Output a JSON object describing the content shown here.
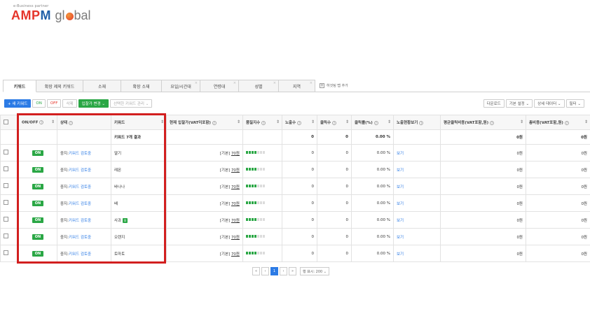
{
  "logo": {
    "tagline": "e-Business partner",
    "name_a": "AMP",
    "name_b": "M",
    "name_c": "gl",
    "name_d": "bal"
  },
  "tabs": [
    {
      "label": "키워드",
      "active": true
    },
    {
      "label": "확장 제외 키워드"
    },
    {
      "label": "소재"
    },
    {
      "label": "확장 소재"
    },
    {
      "label": "요일/시간대",
      "close": "×"
    },
    {
      "label": "연령대",
      "close": "×"
    },
    {
      "label": "성별",
      "close": "×"
    },
    {
      "label": "지역",
      "close": "×"
    }
  ],
  "tab_add_label": "하것팅 탭 추가",
  "toolbar": {
    "new_keyword": "+ 새 키워드",
    "on": "ON",
    "off": "OFF",
    "delete": "삭제",
    "bid_change": "입찰가 변경 ⌄",
    "selected_manage": "선택한 키워드 관리 ⌄",
    "download": "다운로드",
    "basic_settings": "기본 설정 ⌄",
    "detail_data": "상세 데이터 ⌄",
    "filter": "필터 ⌄"
  },
  "columns": {
    "onoff": "ON/OFF",
    "status": "상태",
    "keyword": "키워드",
    "bid": "현재 입찰가(VAT미포함)",
    "quality": "품질지수",
    "impressions": "노출수",
    "clicks": "클릭수",
    "ctr": "클릭률(%)",
    "view_exposure": "노출현황보기",
    "avg_cpc": "평균클릭비용(VAT포함,원)",
    "total_cost": "총비용(VAT포함,원)"
  },
  "summary": {
    "label": "키워드 7개 결과",
    "impressions": "0",
    "clicks": "0",
    "ctr": "0.00 %",
    "avg_cpc": "0원",
    "total_cost": "0원"
  },
  "rows": [
    {
      "onoff": "ON",
      "status_prefix": "중지:",
      "status_link": "키워드 검토중",
      "keyword": "딸기",
      "bid_prefix": "[기본]",
      "bid_value": "70원",
      "quality": 4,
      "impressions": "0",
      "clicks": "0",
      "ctr": "0.00 %",
      "view": "보기",
      "avg_cpc": "0원",
      "total_cost": "0원"
    },
    {
      "onoff": "ON",
      "status_prefix": "중지:",
      "status_link": "키워드 검토중",
      "keyword": "레몬",
      "bid_prefix": "[기본]",
      "bid_value": "70원",
      "quality": 4,
      "impressions": "0",
      "clicks": "0",
      "ctr": "0.00 %",
      "view": "보기",
      "avg_cpc": "0원",
      "total_cost": "0원"
    },
    {
      "onoff": "ON",
      "status_prefix": "중지:",
      "status_link": "키워드 검토중",
      "keyword": "바나나",
      "bid_prefix": "[기본]",
      "bid_value": "70원",
      "quality": 4,
      "impressions": "0",
      "clicks": "0",
      "ctr": "0.00 %",
      "view": "보기",
      "avg_cpc": "0원",
      "total_cost": "0원"
    },
    {
      "onoff": "ON",
      "status_prefix": "중지:",
      "status_link": "키워드 검토중",
      "keyword": "배",
      "bid_prefix": "[기본]",
      "bid_value": "70원",
      "quality": 4,
      "impressions": "0",
      "clicks": "0",
      "ctr": "0.00 %",
      "view": "보기",
      "avg_cpc": "0원",
      "total_cost": "0원"
    },
    {
      "onoff": "ON",
      "status_prefix": "중지:",
      "status_link": "키워드 검토중",
      "keyword": "사과",
      "badge": "B",
      "bid_prefix": "[기본]",
      "bid_value": "70원",
      "quality": 4,
      "impressions": "0",
      "clicks": "0",
      "ctr": "0.00 %",
      "view": "보기",
      "avg_cpc": "0원",
      "total_cost": "0원"
    },
    {
      "onoff": "ON",
      "status_prefix": "중지:",
      "status_link": "키워드 검토중",
      "keyword": "오렌지",
      "bid_prefix": "[기본]",
      "bid_value": "70원",
      "quality": 4,
      "impressions": "0",
      "clicks": "0",
      "ctr": "0.00 %",
      "view": "보기",
      "avg_cpc": "0원",
      "total_cost": "0원"
    },
    {
      "onoff": "ON",
      "status_prefix": "중지:",
      "status_link": "키워드 검토중",
      "keyword": "토마토",
      "bid_prefix": "[기본]",
      "bid_value": "70원",
      "quality": 4,
      "impressions": "0",
      "clicks": "0",
      "ctr": "0.00 %",
      "view": "보기",
      "avg_cpc": "0원",
      "total_cost": "0원"
    }
  ],
  "pager": {
    "first": "«",
    "prev": "‹",
    "current": "1",
    "next": "›",
    "last": "»",
    "rows_per_page": "행 표시: 200 ⌄"
  },
  "colors": {
    "accent": "#2c7be5",
    "on_green": "#2aa745",
    "highlight_red": "#d21f1f"
  }
}
